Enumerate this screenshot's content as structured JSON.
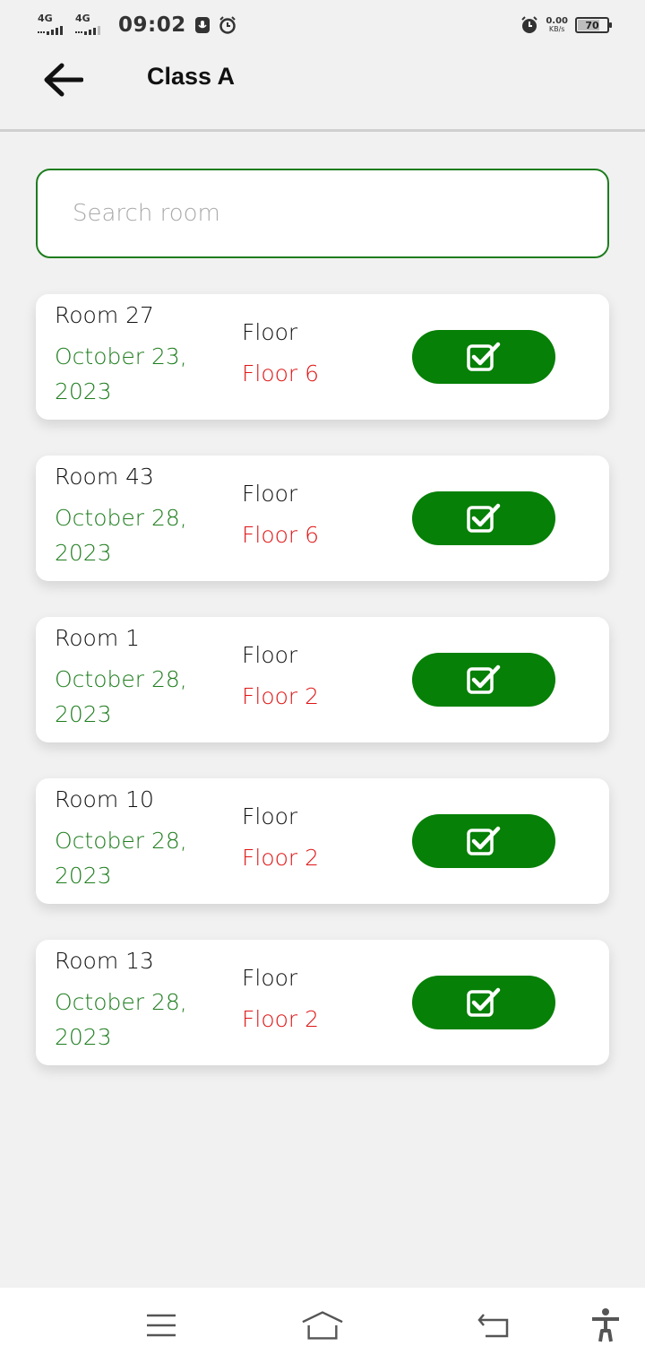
{
  "status_bar": {
    "net1": "4G",
    "net2": "4G",
    "time": "09:02",
    "speed_value": "0.00",
    "speed_unit": "KB/s",
    "battery_level": "70",
    "icons": [
      "signal-icon",
      "signal-icon",
      "voicemail-icon",
      "alarm-icon",
      "alarm-icon",
      "battery-icon"
    ]
  },
  "app_bar": {
    "title": "Class A",
    "back_icon": "arrow-left-icon"
  },
  "search": {
    "placeholder": "Search room",
    "value": ""
  },
  "colors": {
    "accent_green": "#068006",
    "date_green": "#1e7d1e",
    "floor_red": "#e01515",
    "background": "#f1f1f1"
  },
  "rooms": [
    {
      "name": "Room 27",
      "date": "October 23, 2023",
      "floor_label": "Floor",
      "floor": "Floor 6",
      "action_icon": "check-square-icon"
    },
    {
      "name": "Room 43",
      "date": "October 28, 2023",
      "floor_label": "Floor",
      "floor": "Floor 6",
      "action_icon": "check-square-icon"
    },
    {
      "name": "Room 1",
      "date": "October 28, 2023",
      "floor_label": "Floor",
      "floor": "Floor 2",
      "action_icon": "check-square-icon"
    },
    {
      "name": "Room 10",
      "date": "October 28, 2023",
      "floor_label": "Floor",
      "floor": "Floor 2",
      "action_icon": "check-square-icon"
    },
    {
      "name": "Room 13",
      "date": "October 28, 2023",
      "floor_label": "Floor",
      "floor": "Floor 2",
      "action_icon": "check-square-icon"
    }
  ],
  "nav_bar": {
    "icons": [
      "menu-icon",
      "home-icon",
      "back-icon",
      "accessibility-icon"
    ]
  }
}
